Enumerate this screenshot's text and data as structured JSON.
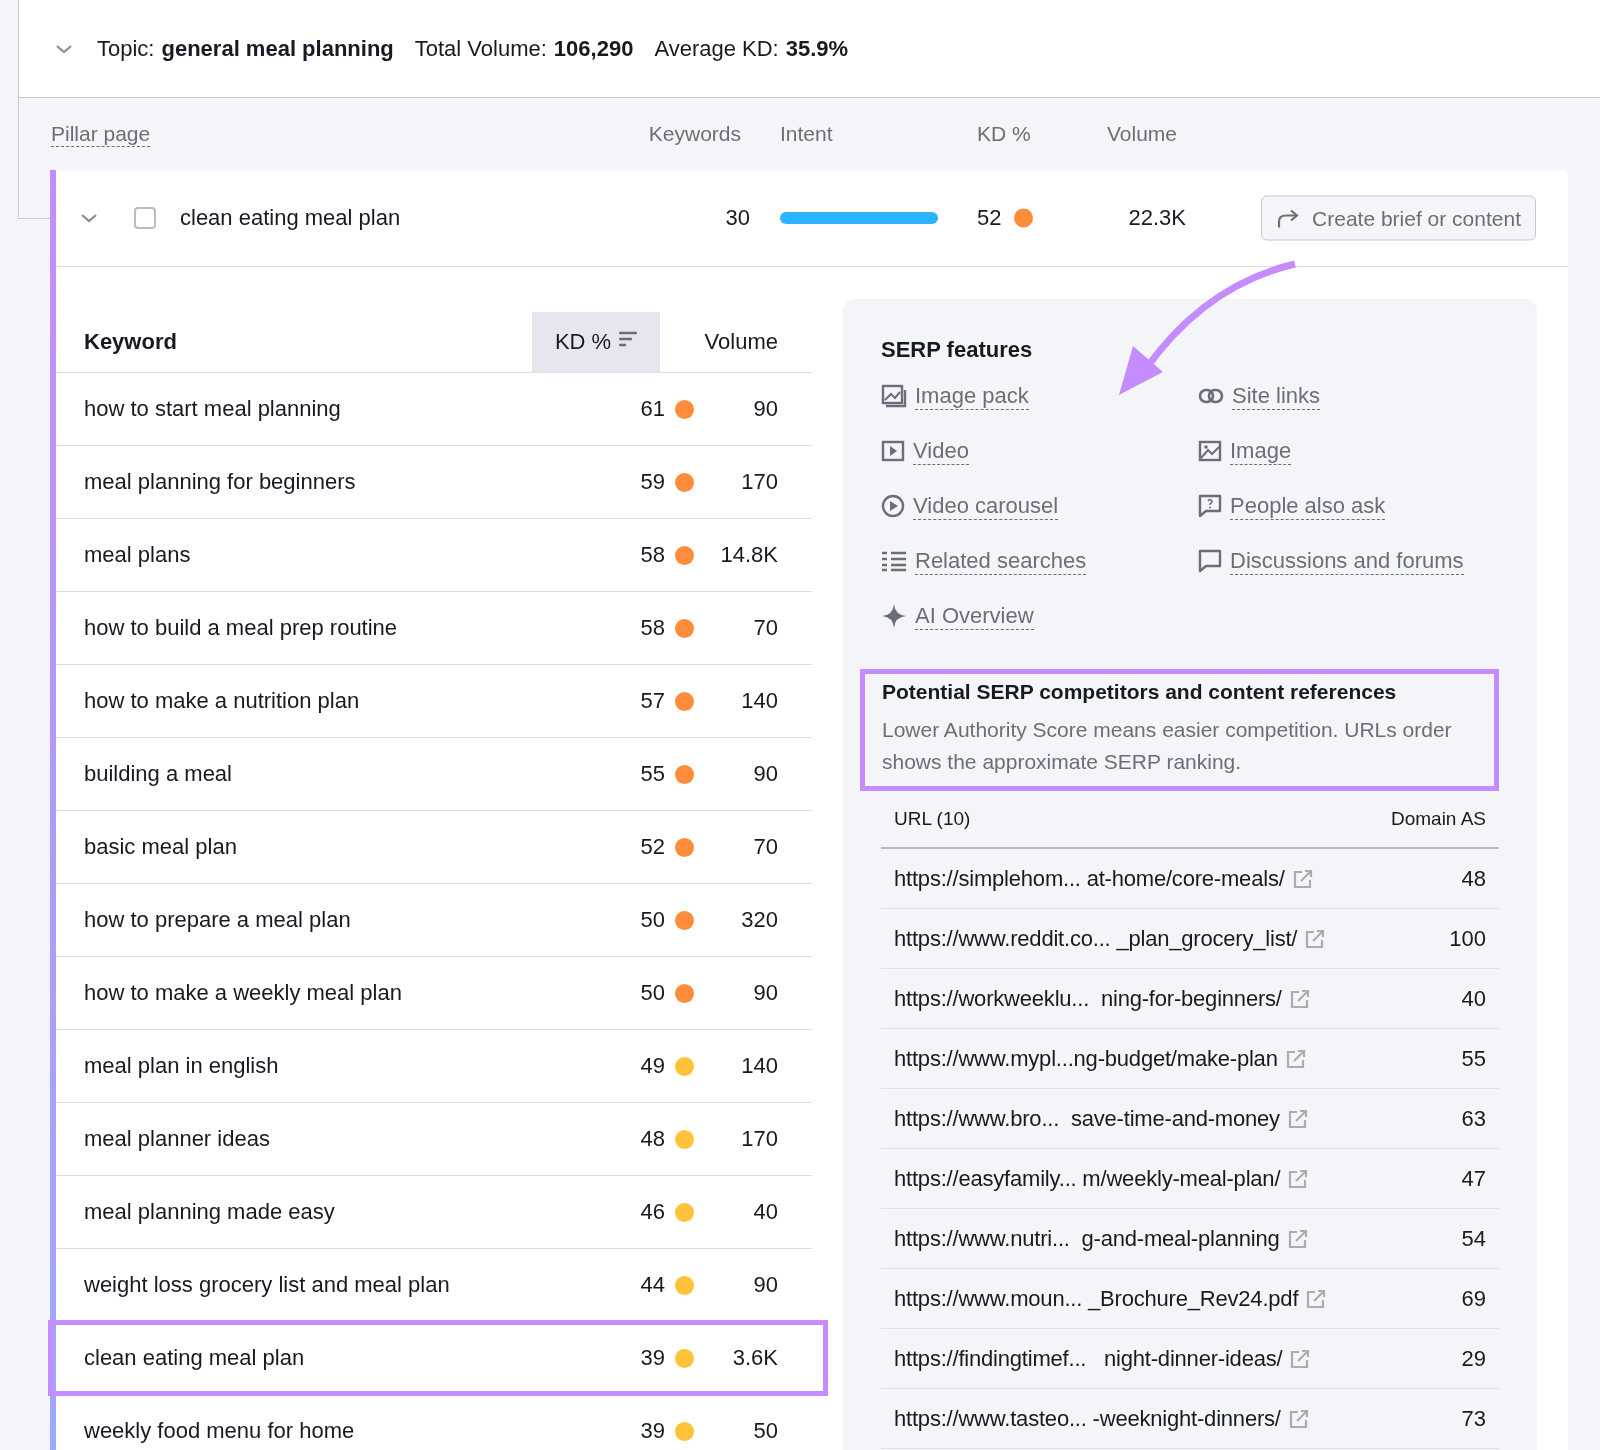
{
  "topic": {
    "expanded": true,
    "label": "Topic:",
    "name": "general meal planning",
    "volume_label": "Total Volume:",
    "volume": "106,290",
    "kd_label": "Average KD:",
    "kd": "35.9%"
  },
  "pillar_header": {
    "pillar": "Pillar page",
    "keywords": "Keywords",
    "intent": "Intent",
    "kd": "KD %",
    "volume": "Volume"
  },
  "pillar": {
    "expanded": true,
    "checked": false,
    "name": "clean eating meal plan",
    "keywords": "30",
    "kd": "52",
    "color": "#ff8c3b",
    "volume": "22.3K",
    "button": "Create brief or content"
  },
  "keyword_table": {
    "columns": [
      {
        "label": "Keyword",
        "sorted": false
      },
      {
        "label": "KD %",
        "sorted": true
      },
      {
        "label": "Volume",
        "sorted": false
      }
    ],
    "rows": [
      {
        "keyword": "how to start meal planning",
        "kd": "61",
        "color": "#ff8c3b",
        "volume": "90",
        "highlighted": false
      },
      {
        "keyword": "meal planning for beginners",
        "kd": "59",
        "color": "#ff8c3b",
        "volume": "170",
        "highlighted": false
      },
      {
        "keyword": "meal plans",
        "kd": "58",
        "color": "#ff8c3b",
        "volume": "14.8K",
        "highlighted": false
      },
      {
        "keyword": "how to build a meal prep routine",
        "kd": "58",
        "color": "#ff8c3b",
        "volume": "70",
        "highlighted": false
      },
      {
        "keyword": "how to make a nutrition plan",
        "kd": "57",
        "color": "#ff8c3b",
        "volume": "140",
        "highlighted": false
      },
      {
        "keyword": "building a meal",
        "kd": "55",
        "color": "#ff8c3b",
        "volume": "90",
        "highlighted": false
      },
      {
        "keyword": "basic meal plan",
        "kd": "52",
        "color": "#ff8c3b",
        "volume": "70",
        "highlighted": false
      },
      {
        "keyword": "how to prepare a meal plan",
        "kd": "50",
        "color": "#ff8c3b",
        "volume": "320",
        "highlighted": false
      },
      {
        "keyword": "how to make a weekly meal plan",
        "kd": "50",
        "color": "#ff8c3b",
        "volume": "90",
        "highlighted": false
      },
      {
        "keyword": "meal plan in english",
        "kd": "49",
        "color": "#ffc239",
        "volume": "140",
        "highlighted": false
      },
      {
        "keyword": "meal planner ideas",
        "kd": "48",
        "color": "#ffc239",
        "volume": "170",
        "highlighted": false
      },
      {
        "keyword": "meal planning made easy",
        "kd": "46",
        "color": "#ffc239",
        "volume": "40",
        "highlighted": false
      },
      {
        "keyword": "weight loss grocery list and meal plan",
        "kd": "44",
        "color": "#ffc239",
        "volume": "90",
        "highlighted": false
      },
      {
        "keyword": "clean eating meal plan",
        "kd": "39",
        "color": "#ffc239",
        "volume": "3.6K",
        "highlighted": true
      },
      {
        "keyword": "weekly food menu for home",
        "kd": "39",
        "color": "#ffc239",
        "volume": "50",
        "highlighted": false
      }
    ]
  },
  "serp_features": {
    "title": "SERP features",
    "items": [
      {
        "kind": "image-pack",
        "label": "Image pack"
      },
      {
        "kind": "site-links",
        "label": "Site links"
      },
      {
        "kind": "video",
        "label": "Video"
      },
      {
        "kind": "image",
        "label": "Image"
      },
      {
        "kind": "video-carousel",
        "label": "Video carousel"
      },
      {
        "kind": "people-also-ask",
        "label": "People also ask"
      },
      {
        "kind": "related-searches",
        "label": "Related searches"
      },
      {
        "kind": "discussions",
        "label": "Discussions and forums"
      },
      {
        "kind": "ai-overview",
        "label": "AI Overview"
      }
    ]
  },
  "competitors": {
    "highlighted": true,
    "title": "Potential SERP competitors and content references",
    "description": "Lower Authority Score means easier competition. URLs order shows the approximate SERP ranking.",
    "columns": [
      "URL (10)",
      "Domain AS"
    ],
    "rows": [
      {
        "url": "https://simplehom... at-home/core-meals/",
        "as": "48"
      },
      {
        "url": "https://www.reddit.co... _plan_grocery_list/",
        "as": "100"
      },
      {
        "url": "https://workweeklu...  ning-for-beginners/",
        "as": "40"
      },
      {
        "url": "https://www.mypl...ng-budget/make-plan",
        "as": "55"
      },
      {
        "url": "https://www.bro...  save-time-and-money",
        "as": "63"
      },
      {
        "url": "https://easyfamily... m/weekly-meal-plan/",
        "as": "47"
      },
      {
        "url": "https://www.nutri...  g-and-meal-planning",
        "as": "54"
      },
      {
        "url": "https://www.moun... _Brochure_Rev24.pdf",
        "as": "69"
      },
      {
        "url": "https://findingtimef...   night-dinner-ideas/",
        "as": "29"
      },
      {
        "url": "https://www.tasteo... -weeknight-dinners/",
        "as": "73"
      }
    ]
  }
}
